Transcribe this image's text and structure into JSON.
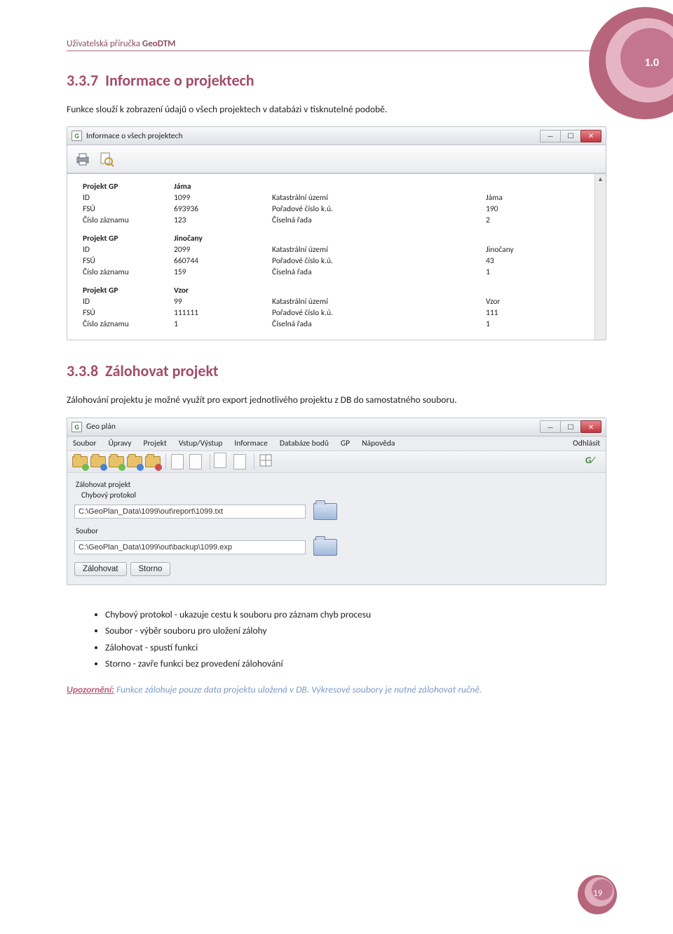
{
  "doc_header": {
    "prefix": "Uživatelská příručka ",
    "name": "GeoDTM"
  },
  "corner_version": "1.0",
  "section1": {
    "number": "3.3.7",
    "title": "Informace o projektech",
    "text": "Funkce slouží k zobrazení údajů o všech projektech v databázi v tisknutelné podobě."
  },
  "window1": {
    "title": "Informace o všech projektech",
    "projects": [
      {
        "name": "Jáma",
        "rows": [
          {
            "label": "ID",
            "val": "1099",
            "label2": "Katastrální území",
            "val2": "Jáma"
          },
          {
            "label": "FSÚ",
            "val": "693936",
            "label2": "Pořadové číslo k.ú.",
            "val2": "190"
          },
          {
            "label": "Číslo záznamu",
            "val": "123",
            "label2": "Číselná řada",
            "val2": "2"
          }
        ]
      },
      {
        "name": "Jinočany",
        "rows": [
          {
            "label": "ID",
            "val": "2099",
            "label2": "Katastrální území",
            "val2": "Jinočany"
          },
          {
            "label": "FSÚ",
            "val": "660744",
            "label2": "Pořadové číslo k.ú.",
            "val2": "43"
          },
          {
            "label": "Číslo záznamu",
            "val": "159",
            "label2": "Číselná řada",
            "val2": "1"
          }
        ]
      },
      {
        "name": "Vzor",
        "rows": [
          {
            "label": "ID",
            "val": "99",
            "label2": "Katastrální území",
            "val2": "Vzor"
          },
          {
            "label": "FSÚ",
            "val": "111111",
            "label2": "Pořadové číslo k.ú.",
            "val2": "111"
          },
          {
            "label": "Číslo záznamu",
            "val": "1",
            "label2": "Číselná řada",
            "val2": "1"
          }
        ]
      }
    ],
    "row_header_label": "Projekt GP"
  },
  "section2": {
    "number": "3.3.8",
    "title": "Zálohovat projekt",
    "text": "Zálohování projektu je možné využít pro export jednotlivého projektu z DB do samostatného souboru."
  },
  "window2": {
    "title": "Geo plán",
    "menu": [
      "Soubor",
      "Úpravy",
      "Projekt",
      "Vstup/Výstup",
      "Informace",
      "Databáze bodů",
      "GP",
      "Nápověda"
    ],
    "menu_right": "Odhlásit",
    "group_title": "Zálohovat projekt",
    "field1_label": "Chybový protokol",
    "field1_value": "C:\\GeoPlan_Data\\1099\\out\\report\\1099.txt",
    "field2_label": "Soubor",
    "field2_value": "C:\\GeoPlan_Data\\1099\\out\\backup\\1099.exp",
    "btn_ok": "Zálohovat",
    "btn_cancel": "Storno"
  },
  "bullets": [
    "Chybový protokol - ukazuje cestu k souboru pro záznam chyb procesu",
    "Soubor - výběr souboru pro uložení zálohy",
    "Zálohovat - spustí funkci",
    "Storno - zavře funkci bez provedení zálohování"
  ],
  "upoz": {
    "label": "Upozornění:",
    "text": " Funkce zálohuje pouze data projektu uložená v DB. Výkresové soubory je nutné zálohovat ručně."
  },
  "page_number": "19"
}
